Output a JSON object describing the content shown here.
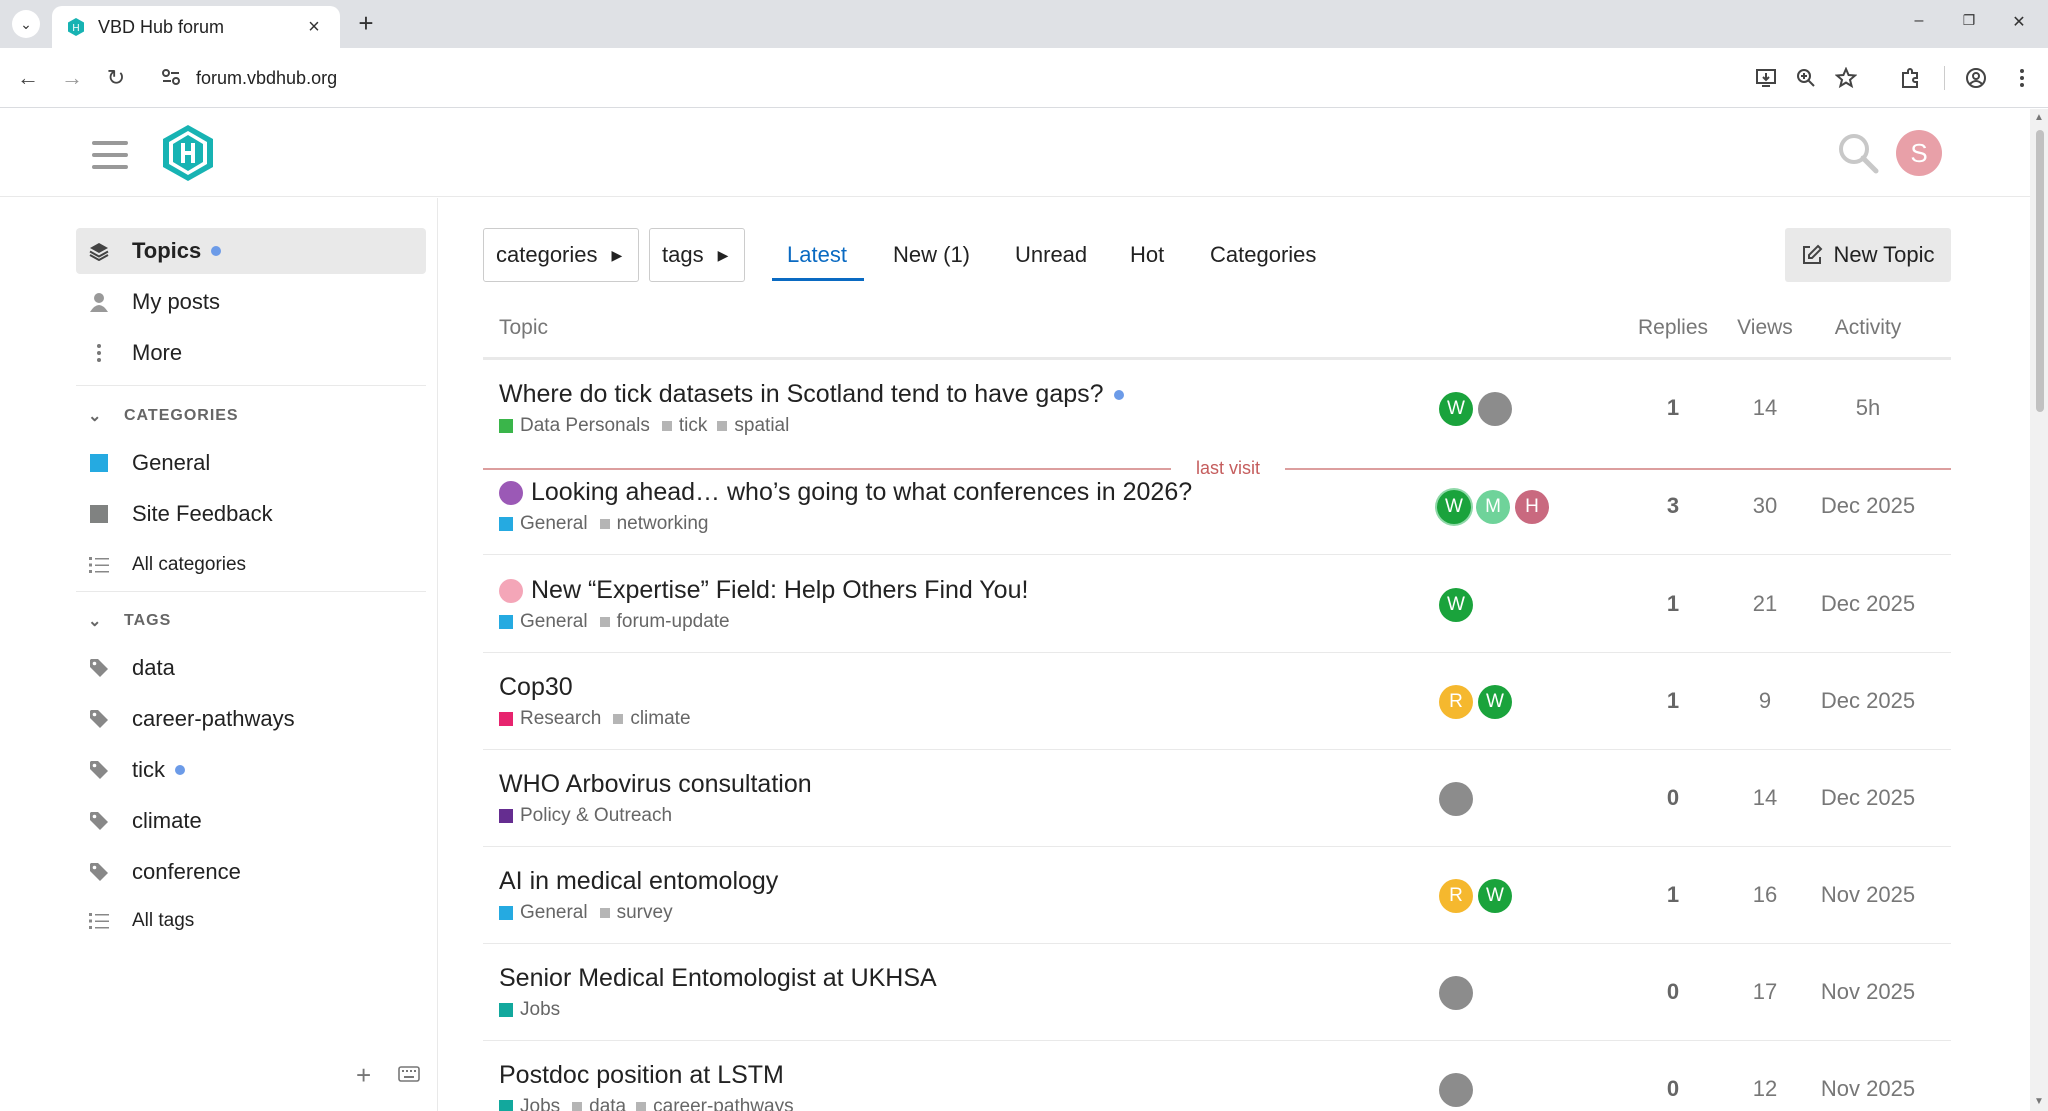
{
  "browser": {
    "tab_title": "VBD Hub forum",
    "url": "forum.vbdhub.org"
  },
  "sidebar": {
    "main_links": [
      {
        "label": "Topics"
      },
      {
        "label": "My posts"
      },
      {
        "label": "More"
      }
    ],
    "categories_heading": "CATEGORIES",
    "categories": [
      {
        "label": "General",
        "color": "#25aae1"
      },
      {
        "label": "Site Feedback",
        "color": "#808281"
      }
    ],
    "all_categories": "All categories",
    "tags_heading": "TAGS",
    "tags": [
      {
        "label": "data"
      },
      {
        "label": "career-pathways"
      },
      {
        "label": "tick"
      },
      {
        "label": "climate"
      },
      {
        "label": "conference"
      }
    ],
    "all_tags": "All tags"
  },
  "header": {
    "avatar_letter": "S",
    "avatar_color": "#e8a0a8"
  },
  "filters": {
    "categories_label": "categories",
    "tags_label": "tags"
  },
  "nav": {
    "tabs": [
      "Latest",
      "New (1)",
      "Unread",
      "Hot",
      "Categories"
    ],
    "active": "Latest",
    "new_topic": "New Topic"
  },
  "columns": {
    "topic": "Topic",
    "replies": "Replies",
    "views": "Views",
    "activity": "Activity"
  },
  "last_visit_label": "last visit",
  "topics": [
    {
      "title": "Where do tick datasets in Scotland tend to have gaps?",
      "category": "Data Personals",
      "category_color": "#3ab54a",
      "tags": [
        "tick",
        "spatial"
      ],
      "replies": "1",
      "views": "14",
      "activity": "5h"
    },
    {
      "title": "Looking ahead… who’s going to what conferences in 2026?",
      "category": "General",
      "category_color": "#25aae1",
      "tags": [
        "networking"
      ],
      "replies": "3",
      "views": "30",
      "activity": "Dec 2025"
    },
    {
      "title": "New “Expertise” Field: Help Others Find You!",
      "category": "General",
      "category_color": "#25aae1",
      "tags": [
        "forum-update"
      ],
      "replies": "1",
      "views": "21",
      "activity": "Dec 2025"
    },
    {
      "title": "Cop30",
      "category": "Research",
      "category_color": "#e7246e",
      "tags": [
        "climate"
      ],
      "replies": "1",
      "views": "9",
      "activity": "Dec 2025"
    },
    {
      "title": "WHO Arbovirus consultation",
      "category": "Policy & Outreach",
      "category_color": "#652d90",
      "tags": [],
      "replies": "0",
      "views": "14",
      "activity": "Dec 2025"
    },
    {
      "title": "AI in medical entomology",
      "category": "General",
      "category_color": "#25aae1",
      "tags": [
        "survey"
      ],
      "replies": "1",
      "views": "16",
      "activity": "Nov 2025"
    },
    {
      "title": "Senior Medical Entomologist at UKHSA",
      "category": "Jobs",
      "category_color": "#12a89d",
      "tags": [],
      "replies": "0",
      "views": "17",
      "activity": "Nov 2025"
    },
    {
      "title": "Postdoc position at LSTM",
      "category": "Jobs",
      "category_color": "#12a89d",
      "tags": [
        "data",
        "career-pathways"
      ],
      "replies": "0",
      "views": "12",
      "activity": "Nov 2025"
    }
  ],
  "posters": [
    [
      {
        "letter": "W",
        "color": "#1aa33c"
      },
      {
        "letter": "",
        "color": "#8c8c8c"
      }
    ],
    [
      {
        "letter": "W",
        "color": "#1aa33c"
      },
      {
        "letter": "M",
        "color": "#6fd39a"
      },
      {
        "letter": "H",
        "color": "#c9697f"
      }
    ],
    [
      {
        "letter": "W",
        "color": "#1aa33c"
      }
    ],
    [
      {
        "letter": "R",
        "color": "#f5b82e"
      },
      {
        "letter": "W",
        "color": "#1aa33c"
      }
    ],
    [
      {
        "letter": "",
        "color": "#8c8c8c"
      }
    ],
    [
      {
        "letter": "R",
        "color": "#f5b82e"
      },
      {
        "letter": "W",
        "color": "#1aa33c"
      }
    ],
    [
      {
        "letter": "",
        "color": "#8c8c8c"
      }
    ],
    [
      {
        "letter": "",
        "color": "#8c8c8c"
      }
    ]
  ]
}
